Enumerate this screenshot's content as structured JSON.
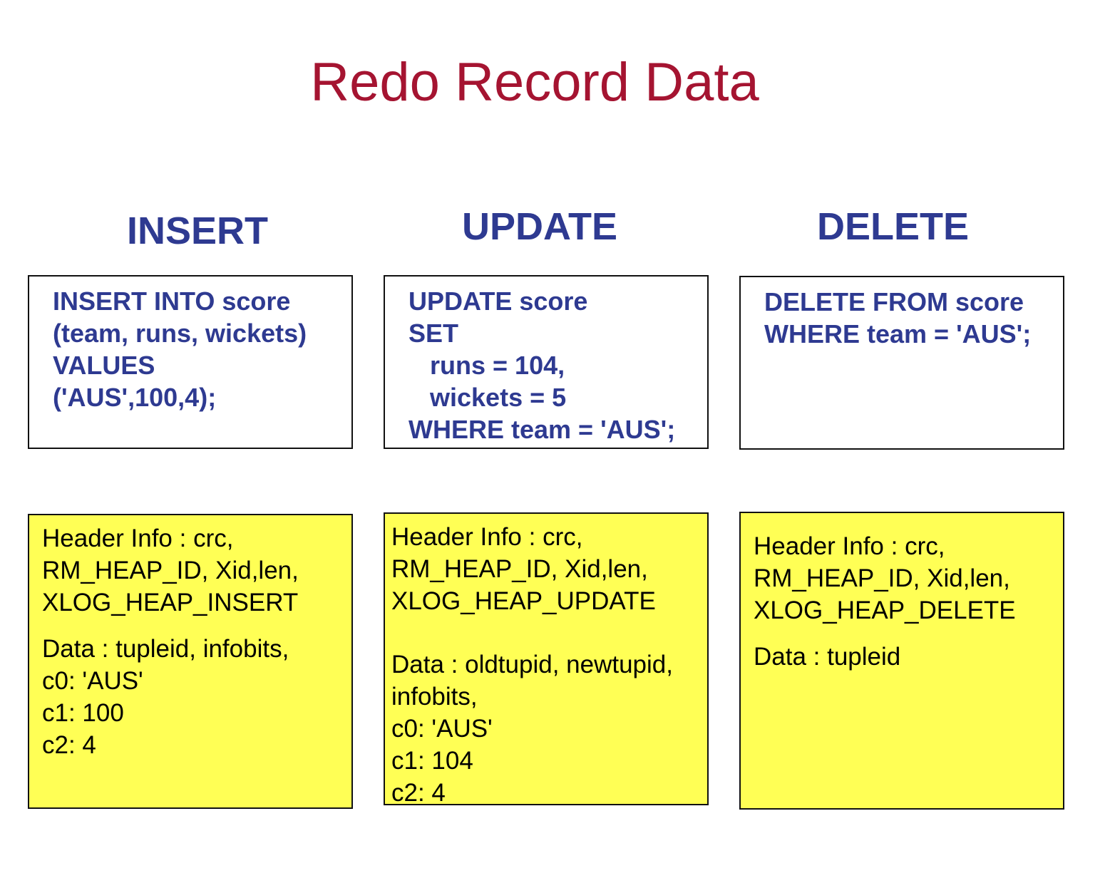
{
  "title": "Redo Record Data",
  "colors": {
    "title": "#a51431",
    "heading": "#2e3a91",
    "sql_text": "#2e3a91",
    "log_box_fill": "#ffff55",
    "border": "#111111"
  },
  "columns": [
    {
      "heading": "INSERT",
      "sql": [
        "INSERT INTO score",
        "(team, runs, wickets)",
        "VALUES",
        "('AUS',100,4);"
      ],
      "log": {
        "header": [
          "Header Info : crc,",
          "RM_HEAP_ID, Xid,len,",
          "XLOG_HEAP_INSERT"
        ],
        "data": [
          "Data : tupleid, infobits,",
          "c0: 'AUS'",
          "c1: 100",
          "c2: 4"
        ]
      }
    },
    {
      "heading": "UPDATE",
      "sql": [
        "UPDATE score",
        "SET",
        "   runs = 104,",
        "   wickets = 5",
        "WHERE team = 'AUS';"
      ],
      "log": {
        "header": [
          "Header Info : crc,",
          "RM_HEAP_ID, Xid,len,",
          "XLOG_HEAP_UPDATE"
        ],
        "data": [
          "Data : oldtupid, newtupid,",
          "infobits,",
          "c0: 'AUS'",
          "c1: 104",
          "c2: 4"
        ]
      }
    },
    {
      "heading": "DELETE",
      "sql": [
        "DELETE FROM score",
        "WHERE team = 'AUS';"
      ],
      "log": {
        "header": [
          "Header Info : crc,",
          "RM_HEAP_ID, Xid,len,",
          "XLOG_HEAP_DELETE"
        ],
        "data": [
          "Data : tupleid"
        ]
      }
    }
  ]
}
